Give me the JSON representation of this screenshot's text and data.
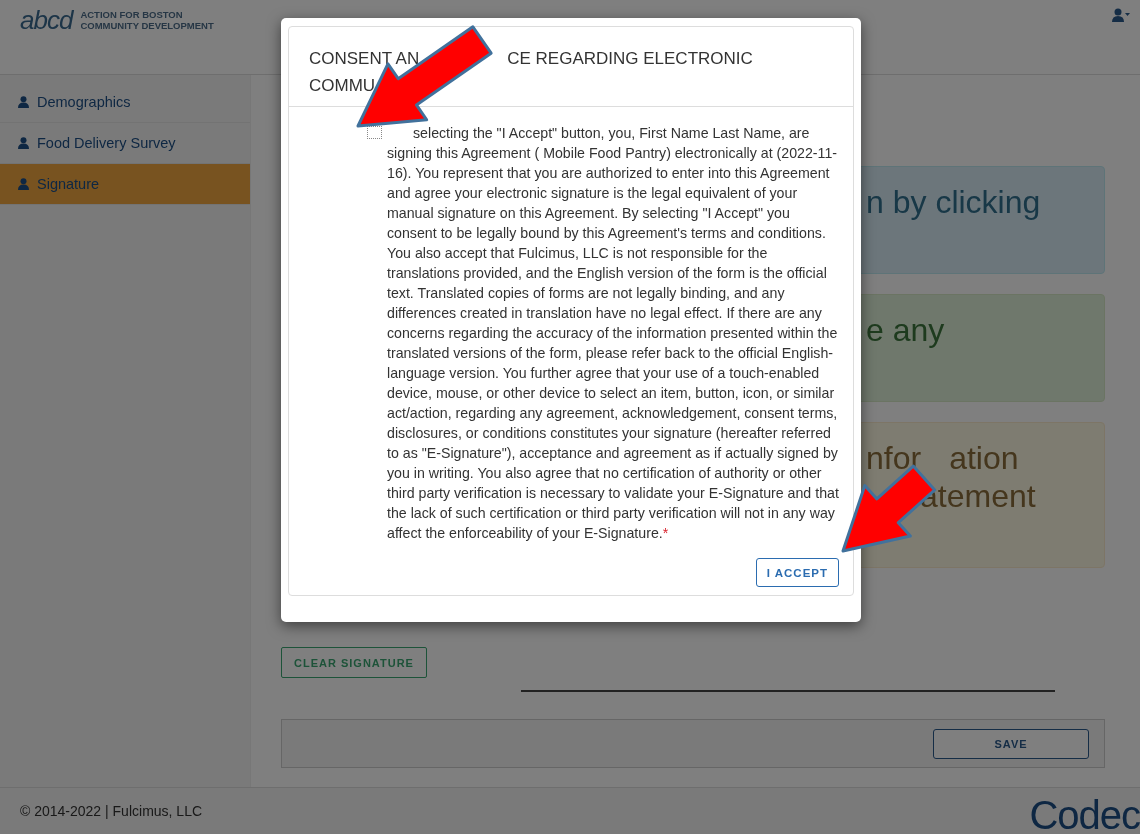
{
  "header": {
    "logo_text": "abcd",
    "org_name_line_1": "ACTION FOR BOSTON",
    "org_name_line_2": "COMMUNITY DEVELOPMENT"
  },
  "sidebar": {
    "items": [
      {
        "label": "Demographics",
        "selected": false
      },
      {
        "label": "Food Delivery Survey",
        "selected": false
      },
      {
        "label": "Signature",
        "selected": true
      }
    ]
  },
  "notices": [
    {
      "kind": "info",
      "lines": [
        [
          "n by clicking"
        ]
      ]
    },
    {
      "kind": "success",
      "lines": [
        [
          "e any"
        ]
      ]
    },
    {
      "kind": "warning",
      "lines": [
        [
          "nfor",
          "ation"
        ],
        [
          "atement"
        ]
      ]
    }
  ],
  "clear_signature_button": "CLEAR SIGNATURE",
  "save_button": "SAVE",
  "footer": {
    "copyright": "© 2014-2022 | Fulcimus, LLC",
    "brand": "Codec"
  },
  "modal": {
    "title_parts": [
      "CONSENT AN",
      "CE REGARDING ELECTRONIC",
      "COMMU"
    ],
    "checkbox": {
      "checked": false
    },
    "body": "selecting the \"I Accept\" button, you, First Name Last Name, are signing this Agreement ( Mobile Food Pantry) electronically at (2022-11-16). You represent that you are authorized to enter into this Agreement and agree your electronic signature is the legal equivalent of your manual signature on this Agreement. By selecting \"I Accept\" you consent to be legally bound by this Agreement's terms and conditions. You also accept that Fulcimus, LLC is not responsible for the translations provided, and the English version of the form is the official text. Translated copies of forms are not legally binding, and any differences created in translation have no legal effect. If there are any concerns regarding the accuracy of the information presented within the translated versions of the form, please refer back to the official English-language version. You further agree that your use of a touch-enabled device, mouse, or other device to select an item, button, icon, or similar act/action, regarding any agreement, acknowledgement, consent terms, disclosures, or conditions constitutes your signature (hereafter referred to as \"E-Signature\"), acceptance and agreement as if actually signed by you in writing. You also agree that no certification of authority or other third party verification is necessary to validate your E-Signature and that the lack of such certification or third party verification will not in any way affect the enforceability of your E-Signature.",
    "required_mark": "*",
    "accept_button": "I ACCEPT"
  }
}
